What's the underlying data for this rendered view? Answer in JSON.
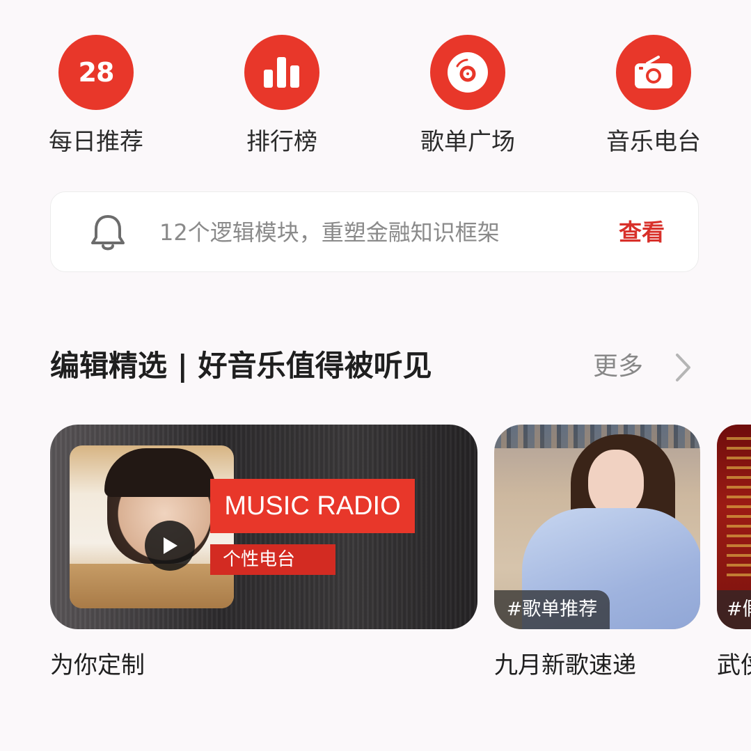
{
  "quick_nav": [
    {
      "label": "每日推荐",
      "icon": "calendar-date-icon",
      "icon_text": "28"
    },
    {
      "label": "排行榜",
      "icon": "bar-chart-icon"
    },
    {
      "label": "歌单广场",
      "icon": "vinyl-disc-icon"
    },
    {
      "label": "音乐电台",
      "icon": "radio-icon"
    }
  ],
  "notice": {
    "icon": "bell-icon",
    "text": "12个逻辑模块，重塑金融知识框架",
    "action": "查看"
  },
  "section": {
    "title": "编辑精选 | 好音乐值得被听见",
    "more": "更多",
    "more_icon": "chevron-right-icon"
  },
  "cards": [
    {
      "caption": "为你定制",
      "tag": "MUSIC RADIO",
      "subtag": "个性电台",
      "icon": "play-icon"
    },
    {
      "caption": "九月新歌速递",
      "badge": "#歌单推荐"
    },
    {
      "caption": "武侠",
      "badge": "#假"
    }
  ],
  "colors": {
    "accent": "#e8372a",
    "accent_text": "#d8302a",
    "background": "#fbf8fa"
  }
}
